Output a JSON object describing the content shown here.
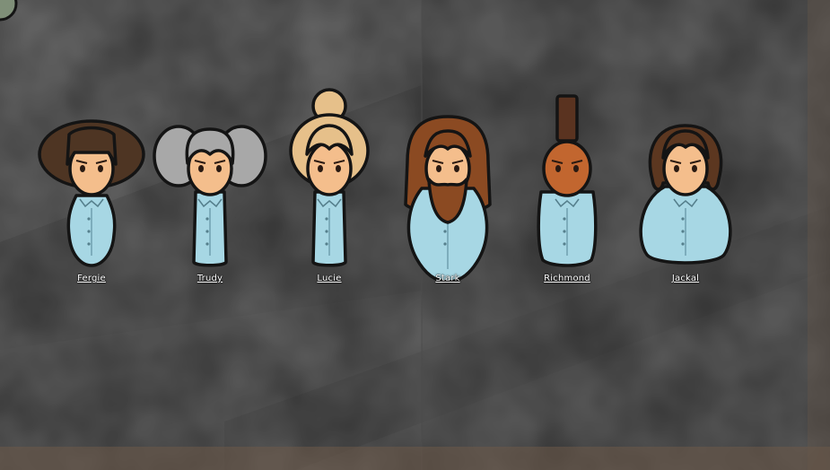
{
  "colors": {
    "floor_left": "#5f5f5f",
    "floor_right": "#575757",
    "floor_top": "#6a6a6a",
    "outline": "#141414",
    "skin": "#f4be8c",
    "skin_dark": "#c2662f",
    "shirt": "#a7d7e4",
    "label": "#ffffff"
  },
  "colonists": [
    {
      "name": "Fergie",
      "hair": "bowl",
      "hair_color": "#4e3523",
      "body": "round"
    },
    {
      "name": "Trudy",
      "hair": "pigtails",
      "hair_color": "#a8a8a8",
      "body": "thin"
    },
    {
      "name": "Lucie",
      "hair": "bun",
      "hair_color": "#e6c08a",
      "body": "thin"
    },
    {
      "name": "Stark",
      "hair": "long-beard",
      "hair_color": "#8b4a22",
      "body": "big"
    },
    {
      "name": "Richmond",
      "hair": "mohawk",
      "hair_color": "#5a3320",
      "body": "square"
    },
    {
      "name": "Jackal",
      "hair": "curly",
      "hair_color": "#5c3720",
      "body": "wide"
    }
  ]
}
